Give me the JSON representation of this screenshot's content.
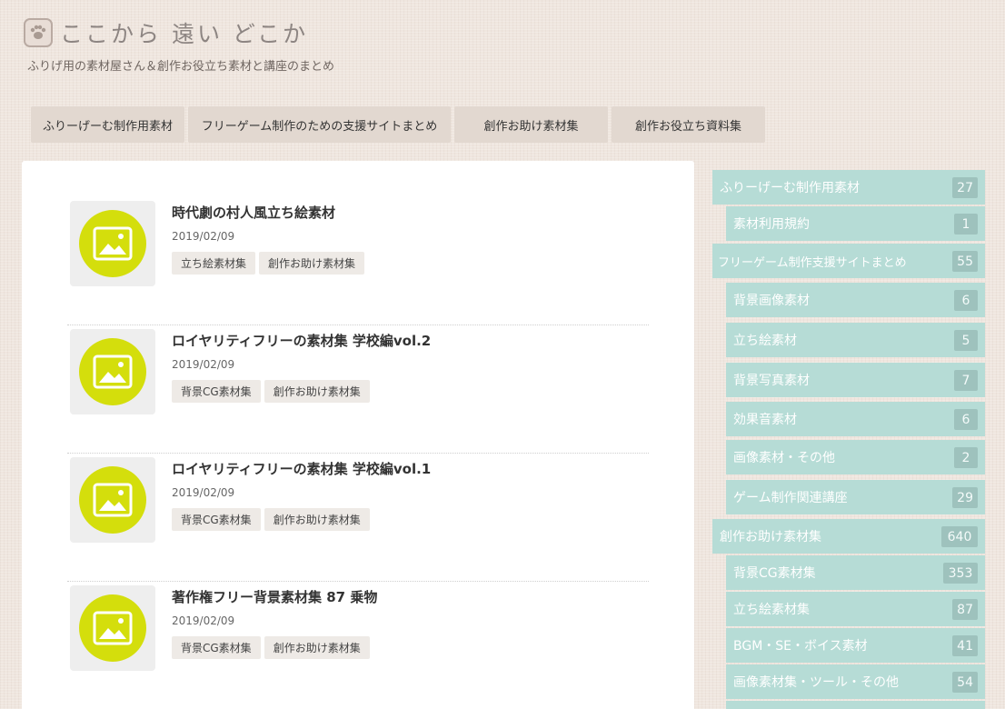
{
  "header": {
    "title": "ここから 遠い どこか",
    "tagline": "ふりげ用の素材屋さん＆創作お役立ち素材と講座のまとめ",
    "logo_icon": "paw-icon"
  },
  "nav": [
    {
      "label": "ふりーげーむ制作用素材"
    },
    {
      "label": "フリーゲーム制作のための支援サイトまとめ"
    },
    {
      "label": "創作お助け素材集"
    },
    {
      "label": "創作お役立ち資料集"
    }
  ],
  "posts": [
    {
      "title": "時代劇の村人風立ち絵素材",
      "date": "2019/02/09",
      "tags": [
        "立ち絵素材集",
        "創作お助け素材集"
      ]
    },
    {
      "title": "ロイヤリティフリーの素材集 学校編vol.2",
      "date": "2019/02/09",
      "tags": [
        "背景CG素材集",
        "創作お助け素材集"
      ]
    },
    {
      "title": "ロイヤリティフリーの素材集 学校編vol.1",
      "date": "2019/02/09",
      "tags": [
        "背景CG素材集",
        "創作お助け素材集"
      ]
    },
    {
      "title": "著作権フリー背景素材集 87 乗物",
      "date": "2019/02/09",
      "tags": [
        "背景CG素材集",
        "創作お助け素材集"
      ]
    }
  ],
  "sidebar": {
    "categories": [
      {
        "label": "ふりーげーむ制作用素材",
        "count": "27"
      },
      {
        "label": "素材利用規約",
        "count": "1"
      },
      {
        "label": "フリーゲーム制作支援サイトまとめ",
        "count": "55"
      },
      {
        "label": "背景画像素材",
        "count": "6"
      },
      {
        "label": "立ち絵素材",
        "count": "5"
      },
      {
        "label": "背景写真素材",
        "count": "7"
      },
      {
        "label": "効果音素材",
        "count": "6"
      },
      {
        "label": "画像素材・その他",
        "count": "2"
      },
      {
        "label": "ゲーム制作関連講座",
        "count": "29"
      },
      {
        "label": "創作お助け素材集",
        "count": "640"
      },
      {
        "label": "背景CG素材集",
        "count": "353"
      },
      {
        "label": "立ち絵素材集",
        "count": "87"
      },
      {
        "label": "BGM・SE・ボイス素材",
        "count": "41"
      },
      {
        "label": "画像素材集・ツール・その他",
        "count": "54"
      }
    ]
  },
  "colors": {
    "accent_lime": "#d4de0c",
    "sidebar_teal": "#b6dcd6",
    "count_badge": "#9ec2bd",
    "nav_bg": "#e2d8d0",
    "page_bg": "#efe6df"
  }
}
